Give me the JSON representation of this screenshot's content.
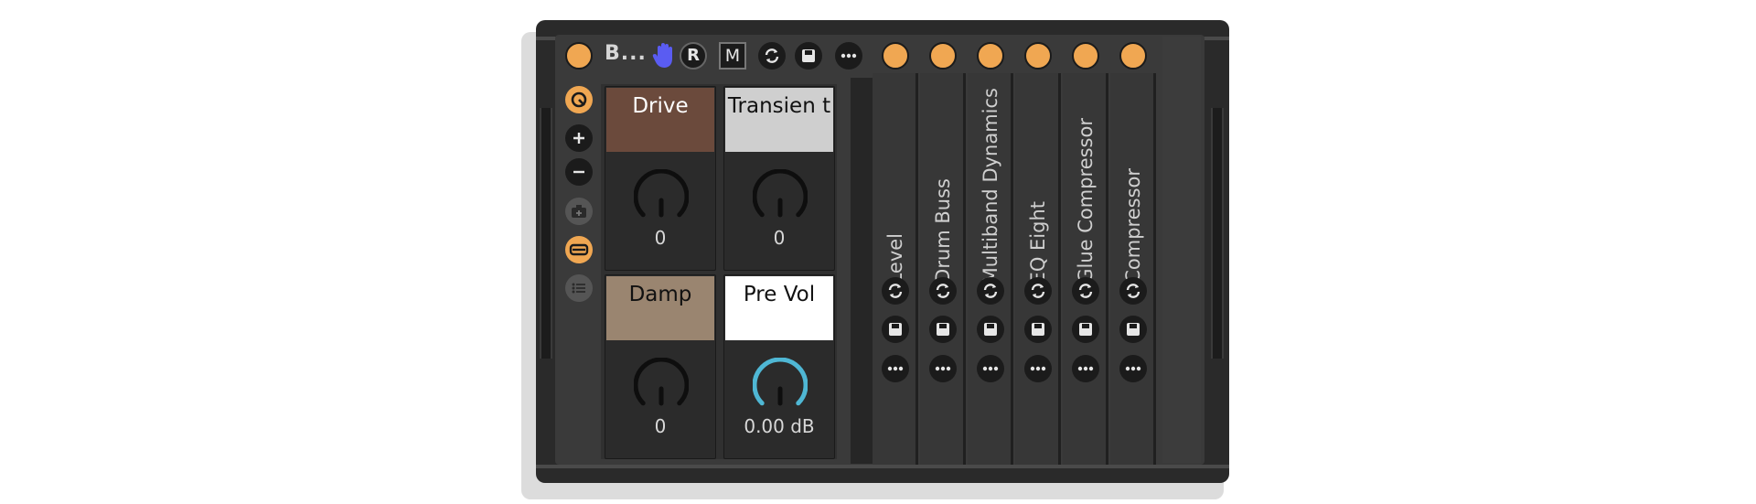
{
  "rack": {
    "title": "B...",
    "buttons": {
      "r_label": "R",
      "m_label": "M"
    }
  },
  "macros": [
    {
      "label": "Drive",
      "value": "0",
      "label_bg": "#6b4a3c",
      "label_color": "#ffffff",
      "knob_level": 0.5
    },
    {
      "label": "Transien t",
      "value": "0",
      "label_bg": "#cfcfcf",
      "label_color": "#111111",
      "knob_level": 0.5
    },
    {
      "label": "Damp",
      "value": "0",
      "label_bg": "#9a8570",
      "label_color": "#111111",
      "knob_level": 0.5
    },
    {
      "label": "Pre Vol",
      "value": "0.00 dB",
      "label_bg": "#ffffff",
      "label_color": "#111111",
      "knob_level": 0.5,
      "knob_color": "#4fb7d4"
    }
  ],
  "chain": [
    {
      "label": "Level"
    },
    {
      "label": "Drum Buss"
    },
    {
      "label": "Multiband Dynamics"
    },
    {
      "label": "EQ Eight"
    },
    {
      "label": "Glue Compressor"
    },
    {
      "label": "Compressor"
    }
  ],
  "icons": {
    "header": [
      "power-toggle-icon",
      "hand-icon",
      "record-button",
      "map-button",
      "sync-icon",
      "save-icon",
      "more-icon"
    ],
    "sidebar": [
      "randomize-icon",
      "plus-icon",
      "minus-icon",
      "snapshot-icon",
      "macro-toggle-icon",
      "list-icon"
    ]
  },
  "colors": {
    "accent": "#f0a752",
    "knob_active": "#4fb7d4",
    "hand_icon": "#5a5cf2"
  }
}
